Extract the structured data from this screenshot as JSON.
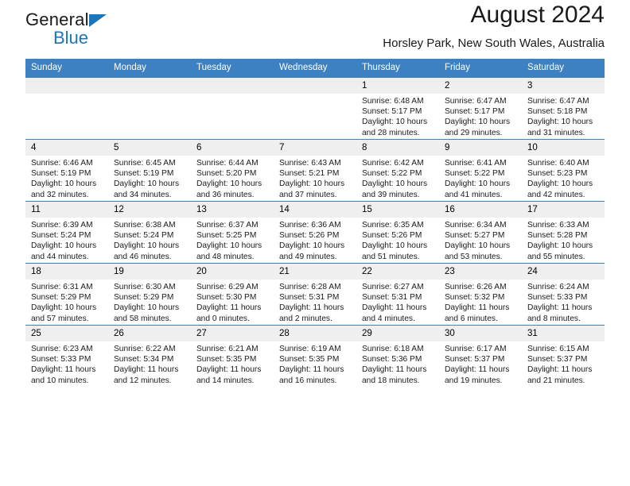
{
  "brand": {
    "name_part1": "General",
    "name_part2": "Blue",
    "triangle_color": "#1b75bb"
  },
  "header": {
    "title": "August 2024",
    "location": "Horsley Park, New South Wales, Australia"
  },
  "theme": {
    "header_blue": "#3d81c2",
    "daynum_gray": "#efefef",
    "text": "#1a1a1a"
  },
  "weekdays": [
    "Sunday",
    "Monday",
    "Tuesday",
    "Wednesday",
    "Thursday",
    "Friday",
    "Saturday"
  ],
  "labels": {
    "sunrise_prefix": "Sunrise:",
    "sunset_prefix": "Sunset:",
    "daylight_prefix": "Daylight:"
  },
  "weeks": [
    [
      {
        "day": "",
        "empty": true
      },
      {
        "day": "",
        "empty": true
      },
      {
        "day": "",
        "empty": true
      },
      {
        "day": "",
        "empty": true
      },
      {
        "day": "1",
        "sunrise": "Sunrise: 6:48 AM",
        "sunset": "Sunset: 5:17 PM",
        "daylight_line1": "Daylight: 10 hours",
        "daylight_line2": "and 28 minutes."
      },
      {
        "day": "2",
        "sunrise": "Sunrise: 6:47 AM",
        "sunset": "Sunset: 5:17 PM",
        "daylight_line1": "Daylight: 10 hours",
        "daylight_line2": "and 29 minutes."
      },
      {
        "day": "3",
        "sunrise": "Sunrise: 6:47 AM",
        "sunset": "Sunset: 5:18 PM",
        "daylight_line1": "Daylight: 10 hours",
        "daylight_line2": "and 31 minutes."
      }
    ],
    [
      {
        "day": "4",
        "sunrise": "Sunrise: 6:46 AM",
        "sunset": "Sunset: 5:19 PM",
        "daylight_line1": "Daylight: 10 hours",
        "daylight_line2": "and 32 minutes."
      },
      {
        "day": "5",
        "sunrise": "Sunrise: 6:45 AM",
        "sunset": "Sunset: 5:19 PM",
        "daylight_line1": "Daylight: 10 hours",
        "daylight_line2": "and 34 minutes."
      },
      {
        "day": "6",
        "sunrise": "Sunrise: 6:44 AM",
        "sunset": "Sunset: 5:20 PM",
        "daylight_line1": "Daylight: 10 hours",
        "daylight_line2": "and 36 minutes."
      },
      {
        "day": "7",
        "sunrise": "Sunrise: 6:43 AM",
        "sunset": "Sunset: 5:21 PM",
        "daylight_line1": "Daylight: 10 hours",
        "daylight_line2": "and 37 minutes."
      },
      {
        "day": "8",
        "sunrise": "Sunrise: 6:42 AM",
        "sunset": "Sunset: 5:22 PM",
        "daylight_line1": "Daylight: 10 hours",
        "daylight_line2": "and 39 minutes."
      },
      {
        "day": "9",
        "sunrise": "Sunrise: 6:41 AM",
        "sunset": "Sunset: 5:22 PM",
        "daylight_line1": "Daylight: 10 hours",
        "daylight_line2": "and 41 minutes."
      },
      {
        "day": "10",
        "sunrise": "Sunrise: 6:40 AM",
        "sunset": "Sunset: 5:23 PM",
        "daylight_line1": "Daylight: 10 hours",
        "daylight_line2": "and 42 minutes."
      }
    ],
    [
      {
        "day": "11",
        "sunrise": "Sunrise: 6:39 AM",
        "sunset": "Sunset: 5:24 PM",
        "daylight_line1": "Daylight: 10 hours",
        "daylight_line2": "and 44 minutes."
      },
      {
        "day": "12",
        "sunrise": "Sunrise: 6:38 AM",
        "sunset": "Sunset: 5:24 PM",
        "daylight_line1": "Daylight: 10 hours",
        "daylight_line2": "and 46 minutes."
      },
      {
        "day": "13",
        "sunrise": "Sunrise: 6:37 AM",
        "sunset": "Sunset: 5:25 PM",
        "daylight_line1": "Daylight: 10 hours",
        "daylight_line2": "and 48 minutes."
      },
      {
        "day": "14",
        "sunrise": "Sunrise: 6:36 AM",
        "sunset": "Sunset: 5:26 PM",
        "daylight_line1": "Daylight: 10 hours",
        "daylight_line2": "and 49 minutes."
      },
      {
        "day": "15",
        "sunrise": "Sunrise: 6:35 AM",
        "sunset": "Sunset: 5:26 PM",
        "daylight_line1": "Daylight: 10 hours",
        "daylight_line2": "and 51 minutes."
      },
      {
        "day": "16",
        "sunrise": "Sunrise: 6:34 AM",
        "sunset": "Sunset: 5:27 PM",
        "daylight_line1": "Daylight: 10 hours",
        "daylight_line2": "and 53 minutes."
      },
      {
        "day": "17",
        "sunrise": "Sunrise: 6:33 AM",
        "sunset": "Sunset: 5:28 PM",
        "daylight_line1": "Daylight: 10 hours",
        "daylight_line2": "and 55 minutes."
      }
    ],
    [
      {
        "day": "18",
        "sunrise": "Sunrise: 6:31 AM",
        "sunset": "Sunset: 5:29 PM",
        "daylight_line1": "Daylight: 10 hours",
        "daylight_line2": "and 57 minutes."
      },
      {
        "day": "19",
        "sunrise": "Sunrise: 6:30 AM",
        "sunset": "Sunset: 5:29 PM",
        "daylight_line1": "Daylight: 10 hours",
        "daylight_line2": "and 58 minutes."
      },
      {
        "day": "20",
        "sunrise": "Sunrise: 6:29 AM",
        "sunset": "Sunset: 5:30 PM",
        "daylight_line1": "Daylight: 11 hours",
        "daylight_line2": "and 0 minutes."
      },
      {
        "day": "21",
        "sunrise": "Sunrise: 6:28 AM",
        "sunset": "Sunset: 5:31 PM",
        "daylight_line1": "Daylight: 11 hours",
        "daylight_line2": "and 2 minutes."
      },
      {
        "day": "22",
        "sunrise": "Sunrise: 6:27 AM",
        "sunset": "Sunset: 5:31 PM",
        "daylight_line1": "Daylight: 11 hours",
        "daylight_line2": "and 4 minutes."
      },
      {
        "day": "23",
        "sunrise": "Sunrise: 6:26 AM",
        "sunset": "Sunset: 5:32 PM",
        "daylight_line1": "Daylight: 11 hours",
        "daylight_line2": "and 6 minutes."
      },
      {
        "day": "24",
        "sunrise": "Sunrise: 6:24 AM",
        "sunset": "Sunset: 5:33 PM",
        "daylight_line1": "Daylight: 11 hours",
        "daylight_line2": "and 8 minutes."
      }
    ],
    [
      {
        "day": "25",
        "sunrise": "Sunrise: 6:23 AM",
        "sunset": "Sunset: 5:33 PM",
        "daylight_line1": "Daylight: 11 hours",
        "daylight_line2": "and 10 minutes."
      },
      {
        "day": "26",
        "sunrise": "Sunrise: 6:22 AM",
        "sunset": "Sunset: 5:34 PM",
        "daylight_line1": "Daylight: 11 hours",
        "daylight_line2": "and 12 minutes."
      },
      {
        "day": "27",
        "sunrise": "Sunrise: 6:21 AM",
        "sunset": "Sunset: 5:35 PM",
        "daylight_line1": "Daylight: 11 hours",
        "daylight_line2": "and 14 minutes."
      },
      {
        "day": "28",
        "sunrise": "Sunrise: 6:19 AM",
        "sunset": "Sunset: 5:35 PM",
        "daylight_line1": "Daylight: 11 hours",
        "daylight_line2": "and 16 minutes."
      },
      {
        "day": "29",
        "sunrise": "Sunrise: 6:18 AM",
        "sunset": "Sunset: 5:36 PM",
        "daylight_line1": "Daylight: 11 hours",
        "daylight_line2": "and 18 minutes."
      },
      {
        "day": "30",
        "sunrise": "Sunrise: 6:17 AM",
        "sunset": "Sunset: 5:37 PM",
        "daylight_line1": "Daylight: 11 hours",
        "daylight_line2": "and 19 minutes."
      },
      {
        "day": "31",
        "sunrise": "Sunrise: 6:15 AM",
        "sunset": "Sunset: 5:37 PM",
        "daylight_line1": "Daylight: 11 hours",
        "daylight_line2": "and 21 minutes."
      }
    ]
  ]
}
